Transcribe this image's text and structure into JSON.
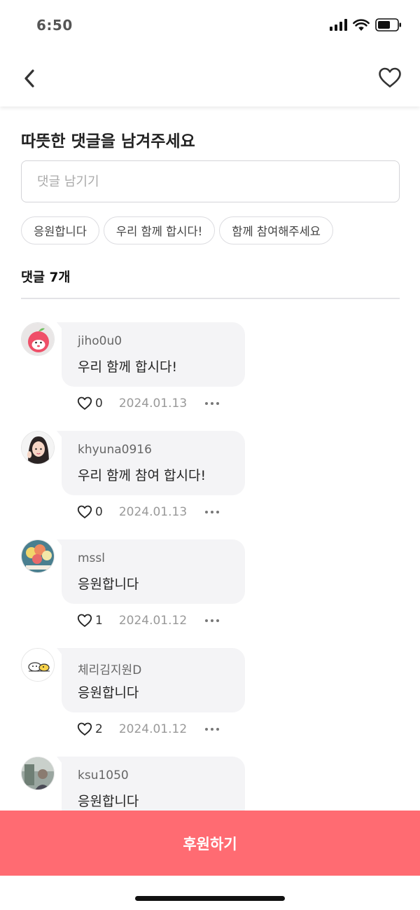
{
  "status_bar": {
    "time": "6:50"
  },
  "header": {
    "back_icon": "chevron-left-icon",
    "favorite_icon": "heart-outline-icon"
  },
  "comment_form": {
    "title": "따뜻한 댓글을 남겨주세요",
    "placeholder": "댓글 남기기",
    "quick_replies": [
      "응원합니다",
      "우리 함께 합시다!",
      "함께 참여해주세요"
    ]
  },
  "comments_header": {
    "label": "댓글 7개"
  },
  "comments": [
    {
      "author": "jiho0u0",
      "text": "우리 함께 합시다!",
      "likes": "0",
      "date": "2024.01.13",
      "avatar": "apple-character-avatar"
    },
    {
      "author": "khyuna0916",
      "text": "우리 함께 참여 합시다!",
      "likes": "0",
      "date": "2024.01.13",
      "avatar": "girl-avatar"
    },
    {
      "author": "mssl",
      "text": "응원합니다",
      "likes": "1",
      "date": "2024.01.12",
      "avatar": "balloons-avatar"
    },
    {
      "author": "체리김지원D",
      "text": "응원합니다",
      "likes": "2",
      "date": "2024.01.12",
      "avatar": "duck-character-avatar"
    },
    {
      "author": "ksu1050",
      "text": "응원합니다",
      "likes": "",
      "date": "",
      "avatar": "photo-avatar"
    }
  ],
  "footer": {
    "donate_label": "후원하기"
  },
  "colors": {
    "accent": "#ff6b72",
    "bubble": "#f4f4f6"
  }
}
